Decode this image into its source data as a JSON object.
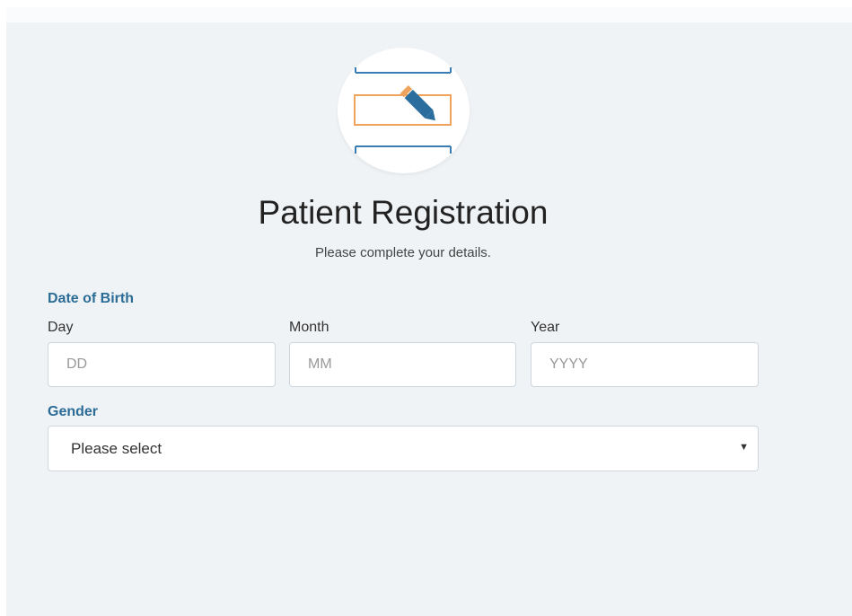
{
  "header": {
    "title": "Patient Registration",
    "subtitle": "Please complete your details."
  },
  "date_of_birth": {
    "label": "Date of Birth",
    "day": {
      "label": "Day",
      "placeholder": "DD"
    },
    "month": {
      "label": "Month",
      "placeholder": "MM"
    },
    "year": {
      "label": "Year",
      "placeholder": "YYYY"
    }
  },
  "gender": {
    "label": "Gender",
    "selected": "Please select",
    "arrow": "▼"
  },
  "colors": {
    "accent": "#2a6c96",
    "icon_blue": "#3a7db4",
    "icon_orange": "#f0a35c",
    "background": "#f0f3f6"
  },
  "icons": {
    "hero": "form-edit-icon"
  }
}
